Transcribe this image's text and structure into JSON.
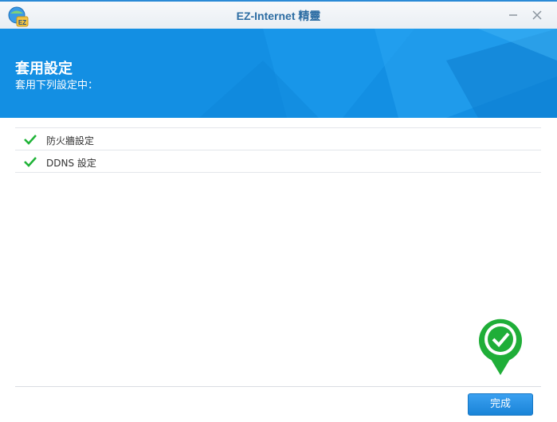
{
  "window": {
    "title": "EZ-Internet 精靈",
    "icon": "ez-app-icon",
    "controls": [
      "minimize-icon",
      "close-icon"
    ]
  },
  "banner": {
    "title": "套用設定",
    "subtitle": "套用下列設定中："
  },
  "steps": [
    {
      "label": "防火牆設定",
      "status": "done",
      "icon": "check-icon"
    },
    {
      "label": "DDNS 設定",
      "status": "done",
      "icon": "check-icon"
    }
  ],
  "footer": {
    "finish_label": "完成"
  },
  "colors": {
    "accent": "#138fe3",
    "success": "#1fb337",
    "title_text": "#2d6da3"
  }
}
